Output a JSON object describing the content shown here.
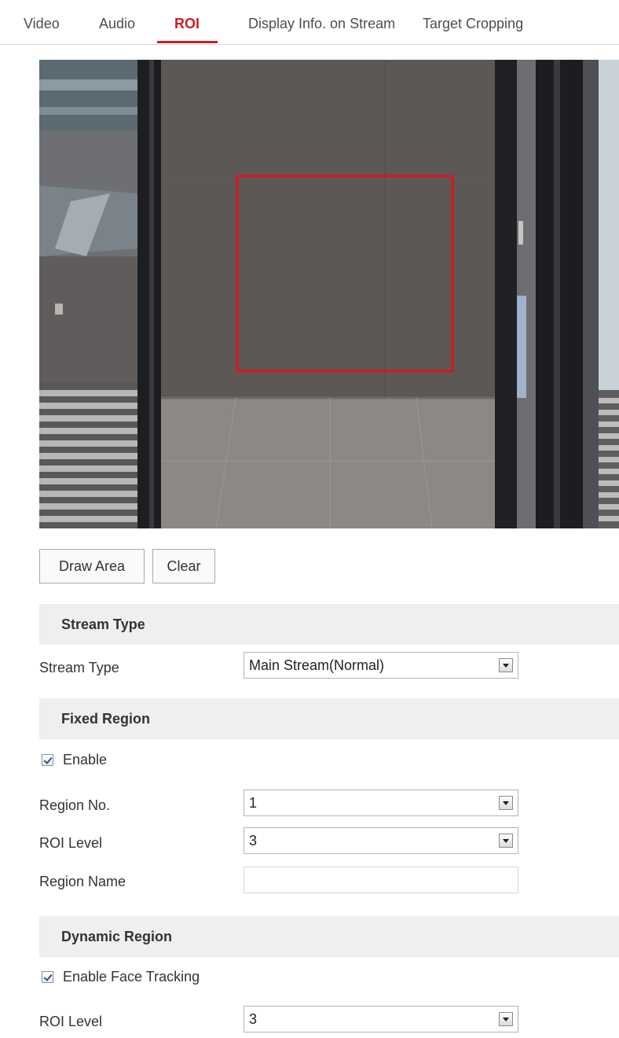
{
  "tabs": [
    {
      "label": "Video"
    },
    {
      "label": "Audio"
    },
    {
      "label": "ROI",
      "active": true
    },
    {
      "label": "Display Info. on Stream"
    },
    {
      "label": "Target Cropping"
    }
  ],
  "accent_color": "#cc1f26",
  "actions": {
    "draw_area": "Draw Area",
    "clear": "Clear"
  },
  "stream_type_section": {
    "title": "Stream Type",
    "field_label": "Stream Type",
    "value": "Main Stream(Normal)"
  },
  "fixed_region": {
    "title": "Fixed Region",
    "enable_label": "Enable",
    "enable_checked": true,
    "region_no_label": "Region No.",
    "region_no_value": "1",
    "roi_level_label": "ROI Level",
    "roi_level_value": "3",
    "region_name_label": "Region Name",
    "region_name_value": ""
  },
  "dynamic_region": {
    "title": "Dynamic Region",
    "face_tracking_label": "Enable Face Tracking",
    "face_tracking_checked": true,
    "roi_level_label": "ROI Level",
    "roi_level_value": "3"
  }
}
